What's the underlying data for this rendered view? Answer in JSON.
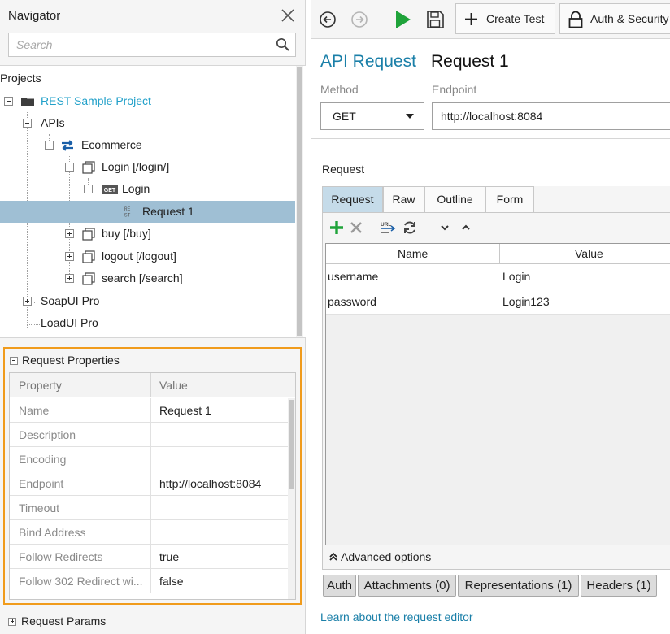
{
  "navigator": {
    "title": "Navigator",
    "search_placeholder": "Search",
    "projects_label": "Projects",
    "tree": [
      {
        "label": "REST Sample Project",
        "kind": "project",
        "icon": "folder-icon",
        "expander": "minus"
      },
      {
        "label": "APIs",
        "kind": "node",
        "expander": "minus"
      },
      {
        "label": "Ecommerce",
        "kind": "api",
        "icon": "rest-api-icon",
        "expander": "minus"
      },
      {
        "label": "Login [/login/]",
        "kind": "resource",
        "icon": "resource-icon",
        "expander": "minus"
      },
      {
        "label": "Login",
        "kind": "method",
        "icon": "get-method-icon",
        "expander": "minus"
      },
      {
        "label": "Request 1",
        "kind": "request",
        "icon": "rest-request-icon",
        "selected": true
      },
      {
        "label": "buy [/buy]",
        "kind": "resource",
        "icon": "resource-icon",
        "expander": "plus"
      },
      {
        "label": "logout [/logout]",
        "kind": "resource",
        "icon": "resource-icon",
        "expander": "plus"
      },
      {
        "label": "search [/search]",
        "kind": "resource",
        "icon": "resource-icon",
        "expander": "plus"
      },
      {
        "label": "SoapUI Pro",
        "kind": "node",
        "expander": "plus"
      },
      {
        "label": "LoadUI Pro",
        "kind": "node"
      }
    ]
  },
  "properties": {
    "header": "Request Properties",
    "col_property": "Property",
    "col_value": "Value",
    "rows": [
      {
        "key": "Name",
        "value": "Request 1"
      },
      {
        "key": "Description",
        "value": ""
      },
      {
        "key": "Encoding",
        "value": ""
      },
      {
        "key": "Endpoint",
        "value": "http://localhost:8084"
      },
      {
        "key": "Timeout",
        "value": ""
      },
      {
        "key": "Bind Address",
        "value": ""
      },
      {
        "key": "Follow Redirects",
        "value": "true"
      },
      {
        "key": "Follow 302 Redirect wi...",
        "value": "false"
      }
    ]
  },
  "params_label": "Request Params",
  "toolbar": {
    "create_test": "Create Test",
    "auth_security": "Auth & Security"
  },
  "editor": {
    "title_type": "API Request",
    "title_name": "Request 1",
    "method_label": "Method",
    "method_value": "GET",
    "endpoint_label": "Endpoint",
    "endpoint_value": "http://localhost:8084",
    "request_label": "Request",
    "tabs": [
      "Request",
      "Raw",
      "Outline",
      "Form"
    ],
    "active_tab": "Request",
    "grid_name": "Name",
    "grid_value": "Value",
    "params": [
      {
        "name": "username",
        "value": "Login"
      },
      {
        "name": "password",
        "value": "Login123"
      }
    ],
    "advanced_options": "Advanced options",
    "bottom_tabs": [
      "Auth",
      "Attachments (0)",
      "Representations (1)",
      "Headers (1)"
    ],
    "learn_link": "Learn about the request editor"
  },
  "colors": {
    "accent": "#1a7fa8",
    "project_text": "#21a0c9",
    "selection": "#9fbfd4",
    "active_tab": "#c5dbe9",
    "highlight_border": "#f09b1c",
    "run_green": "#1fa33a"
  }
}
